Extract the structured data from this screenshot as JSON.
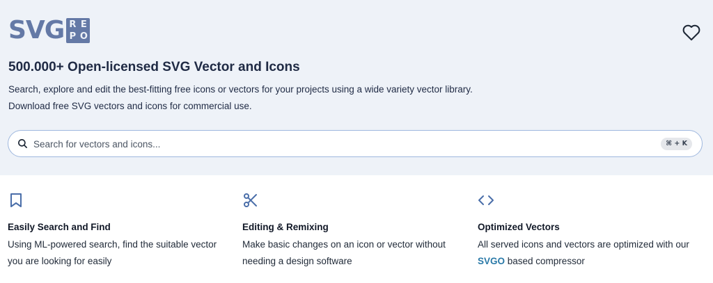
{
  "logo": {
    "word": "SVG",
    "box": [
      "R",
      "E",
      "P",
      "O"
    ]
  },
  "header": {
    "headline": "500.000+ Open-licensed SVG Vector and Icons",
    "desc_line1": "Search, explore and edit the best-fitting free icons or vectors for your projects using a wide variety vector library.",
    "desc_line2": "Download free SVG vectors and icons for commercial use."
  },
  "search": {
    "placeholder": "Search for vectors and icons...",
    "value": "",
    "shortcut": "⌘ + K"
  },
  "features": [
    {
      "icon": "bookmark-icon",
      "title": "Easily Search and Find",
      "line1": "Using ML-powered search, find the suitable vector",
      "line2": "you are looking for easily"
    },
    {
      "icon": "scissors-icon",
      "title": "Editing & Remixing",
      "line1": "Make basic changes on an icon or vector without",
      "line2": "needing a design software"
    },
    {
      "icon": "code-icon",
      "title": "Optimized Vectors",
      "line1": "All served icons and vectors are optimized with our",
      "line2_link": "SVGO",
      "line2_rest": " based compressor"
    }
  ],
  "colors": {
    "hero_bg": "#eef2f8",
    "logo": "#6479a6",
    "accent_icon": "#4a6ea9",
    "link": "#2b7aa8",
    "search_border": "#9eb7de"
  }
}
